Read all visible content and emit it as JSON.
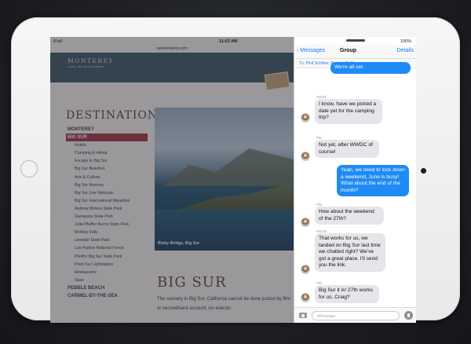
{
  "status_bar": {
    "carrier": "iPad",
    "time": "11:03 AM",
    "battery": "100%"
  },
  "safari": {
    "url": "seemonterey.com",
    "site_logo": "MONTEREY",
    "site_tagline": "county. visit. new destinations.",
    "sidebar_heading": "DESTINATIONS",
    "nav_items": [
      {
        "label": "MONTEREY",
        "type": "section"
      },
      {
        "label": "BIG SUR",
        "type": "active"
      },
      {
        "label": "Hotels",
        "type": "sub"
      },
      {
        "label": "Camping & Hiking",
        "type": "sub"
      },
      {
        "label": "Escape to Big Sur",
        "type": "sub"
      },
      {
        "label": "Big Sur Beaches",
        "type": "sub"
      },
      {
        "label": "Arts & Culture",
        "type": "sub"
      },
      {
        "label": "Big Sur Itinerary",
        "type": "sub"
      },
      {
        "label": "Big Sur Live Webcam",
        "type": "sub"
      },
      {
        "label": "Big Sur International Marathon",
        "type": "sub"
      },
      {
        "label": "Andrew Molera State Park",
        "type": "sub"
      },
      {
        "label": "Garrapata State Park",
        "type": "sub"
      },
      {
        "label": "Julia Pfeiffer Burns State Park",
        "type": "sub"
      },
      {
        "label": "McWay Falls",
        "type": "sub"
      },
      {
        "label": "Limekiln State Park",
        "type": "sub"
      },
      {
        "label": "Los Padres National Forest",
        "type": "sub"
      },
      {
        "label": "Pfeiffer Big Sur State Park",
        "type": "sub"
      },
      {
        "label": "Point Sur Lightstation",
        "type": "sub"
      },
      {
        "label": "Restaurants",
        "type": "sub"
      },
      {
        "label": "Spas",
        "type": "sub"
      },
      {
        "label": "PEBBLE BEACH",
        "type": "section"
      },
      {
        "label": "CARMEL-BY-THE-SEA",
        "type": "section"
      }
    ],
    "hero_caption": "Bixby Bridge, Big Sur",
    "page_title": "BIG SUR",
    "body_text": "The scenery in Big Sur, California cannot be done justice by film or secondhand account. An eclectic"
  },
  "messages": {
    "back_label": "Messages",
    "title": "Group",
    "details_label": "Details",
    "to_label": "To:",
    "recipients": "Phil Schiller, Patrick Coffman",
    "input_placeholder": "iMessage",
    "thread": [
      {
        "id": "m0",
        "direction": "out",
        "text": "We're all set."
      },
      {
        "id": "m1",
        "direction": "in",
        "sender": "Patrick Coffman",
        "text": "I know, have we picked a date yet for the camping trip?"
      },
      {
        "id": "m2",
        "direction": "in",
        "sender": "Phil Schiller",
        "text": "Not yet, after WWDC of course!"
      },
      {
        "id": "m3",
        "direction": "out",
        "text": "Yeah, we need to lock down a weekend, June is busy! What about the end of the month?"
      },
      {
        "id": "m4",
        "direction": "in",
        "sender": "Phil Schiller",
        "text": "How about the weekend of the 27th?"
      },
      {
        "id": "m5",
        "direction": "in",
        "sender": "Patrick Coffman",
        "text": "That works for us, we landed on Big Sur last time we chatted right? We've got a great place. I'll send you the link."
      },
      {
        "id": "m6",
        "direction": "in",
        "sender": "Phil Schiller",
        "text": "Big Sur it is! 27th works for us. Craig?"
      }
    ]
  },
  "colors": {
    "imessage_blue": "#1e8bf5",
    "incoming_bubble": "#e5e5ea",
    "active_nav": "#a03a46",
    "ios_link": "#1a7cf6"
  }
}
